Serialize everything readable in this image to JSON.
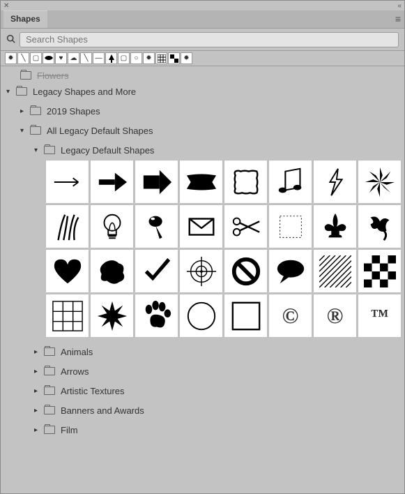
{
  "panel": {
    "title": "Shapes"
  },
  "search": {
    "placeholder": "Search Shapes"
  },
  "tree": {
    "cutoffLabel": "Flowers",
    "legacyMore": "Legacy Shapes and More",
    "y2019": "2019 Shapes",
    "allLegacy": "All Legacy Default Shapes",
    "legacyDefault": "Legacy Default Shapes",
    "animals": "Animals",
    "arrows": "Arrows",
    "artistic": "Artistic Textures",
    "banners": "Banners and Awards",
    "film": "Film"
  },
  "shapes": [
    {
      "name": "arrow-thin-right"
    },
    {
      "name": "arrow-medium-right"
    },
    {
      "name": "arrow-block-right"
    },
    {
      "name": "banner-ribbon"
    },
    {
      "name": "rounded-frame"
    },
    {
      "name": "music-notes"
    },
    {
      "name": "lightning-bolt"
    },
    {
      "name": "flower-petals"
    },
    {
      "name": "grass"
    },
    {
      "name": "light-bulb"
    },
    {
      "name": "push-pin"
    },
    {
      "name": "envelope"
    },
    {
      "name": "scissors"
    },
    {
      "name": "postage-stamp"
    },
    {
      "name": "fleur-de-lis"
    },
    {
      "name": "vine-heart"
    },
    {
      "name": "heart"
    },
    {
      "name": "blob"
    },
    {
      "name": "checkmark"
    },
    {
      "name": "target-crosshair"
    },
    {
      "name": "no-symbol"
    },
    {
      "name": "speech-bubble"
    },
    {
      "name": "diagonal-hatch"
    },
    {
      "name": "checkerboard"
    },
    {
      "name": "grid-3x3"
    },
    {
      "name": "starburst"
    },
    {
      "name": "paw-print"
    },
    {
      "name": "circle-outline"
    },
    {
      "name": "square-outline"
    },
    {
      "name": "copyright",
      "text": "©"
    },
    {
      "name": "registered",
      "text": "®"
    },
    {
      "name": "trademark",
      "text": "™"
    }
  ],
  "recent": [
    "starburst",
    "line",
    "square-outline",
    "banner",
    "heart",
    "cloud",
    "line",
    "line",
    "tree",
    "square-outline",
    "circle-outline",
    "starburst",
    "square-outline",
    "checker",
    "starburst"
  ]
}
